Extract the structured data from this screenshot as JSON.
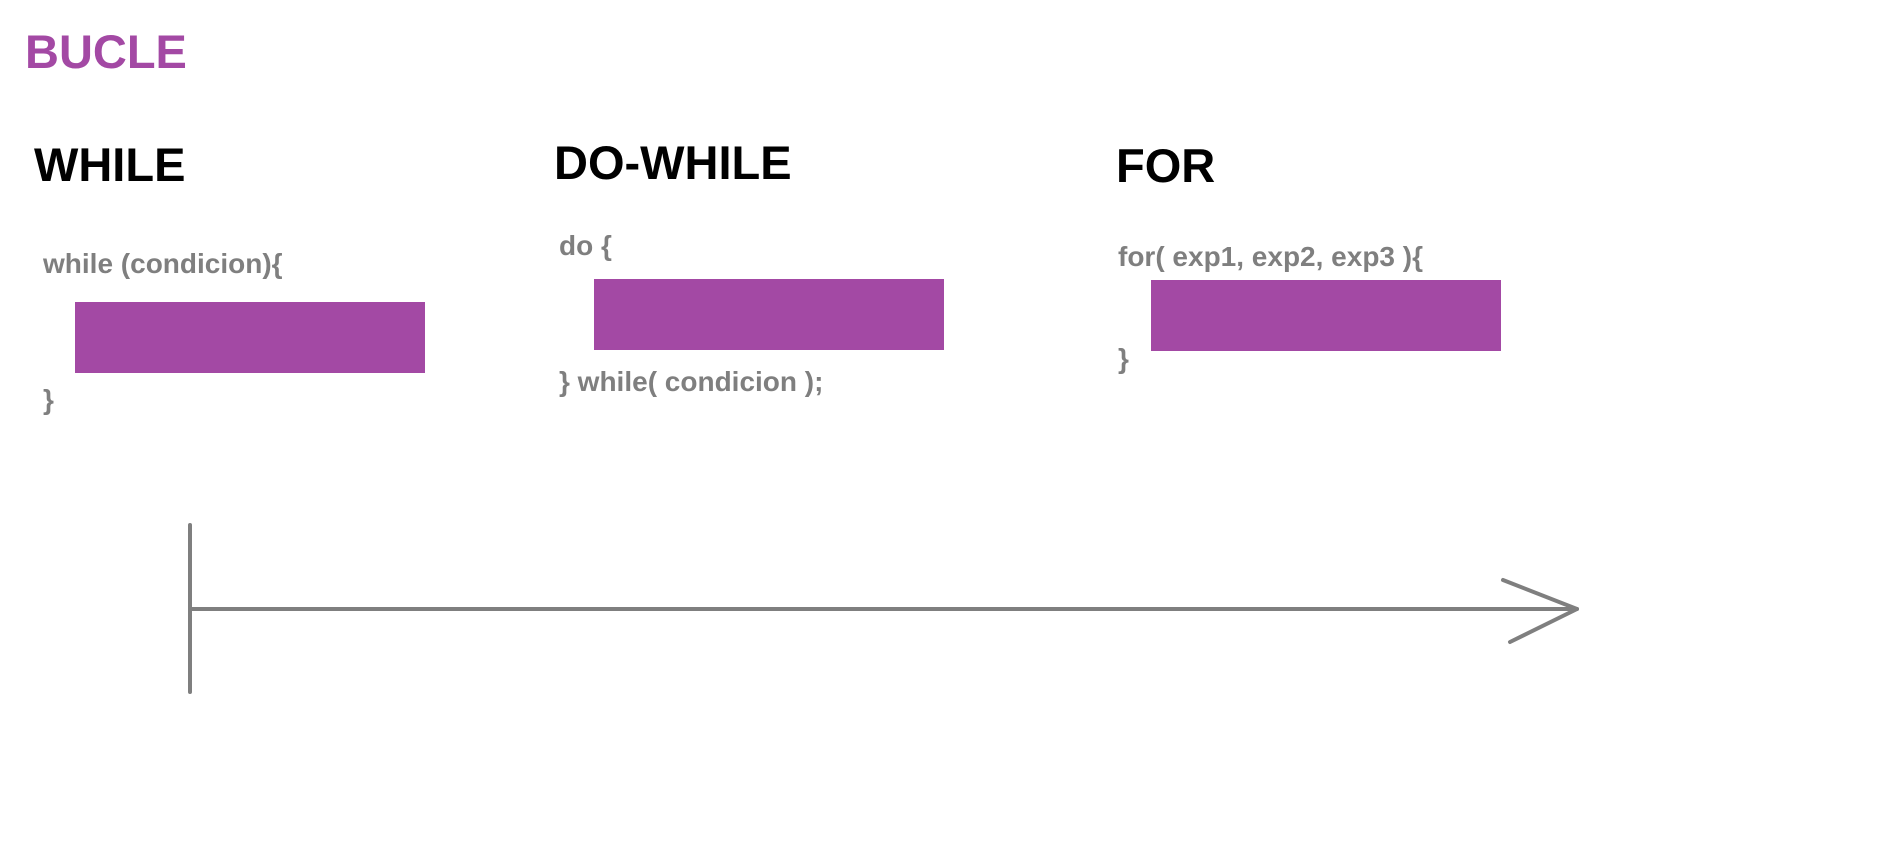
{
  "title": "BUCLE",
  "while": {
    "heading": "WHILE",
    "open": "while (condicion){",
    "close": "}"
  },
  "do_while": {
    "heading": "DO-WHILE",
    "open": "do {",
    "close": "} while( condicion );"
  },
  "for": {
    "heading": "FOR",
    "open": "for( exp1, exp2, exp3 ){",
    "close": "}"
  },
  "colors": {
    "accent": "#a349a4",
    "code_text": "#7f7f7f",
    "heading_text": "#000000",
    "arrow": "#7f7f7f"
  }
}
